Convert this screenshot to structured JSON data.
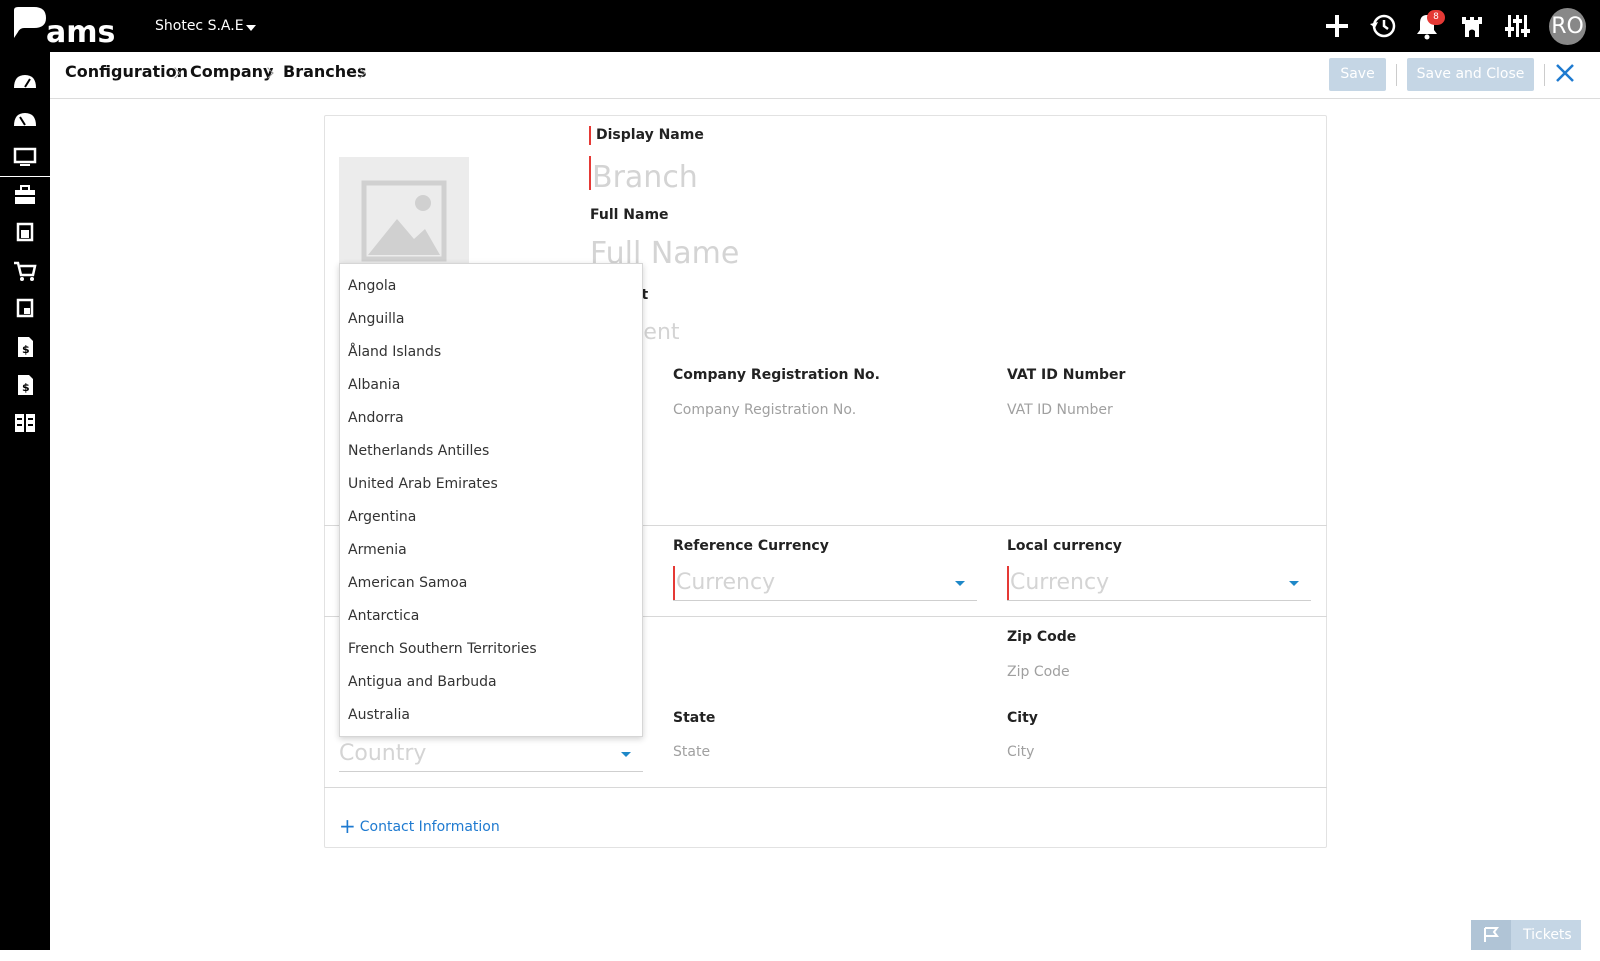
{
  "app": {
    "logo": "Pams",
    "company": "Shotec S.A.E"
  },
  "topbar": {
    "notification_count": "8",
    "avatar_initials": "RO"
  },
  "breadcrumb": [
    "Configuration",
    "Company",
    "Branches"
  ],
  "toolbar": {
    "save_label": "Save",
    "save_close_label": "Save and Close"
  },
  "form": {
    "display_name_label": "Display Name",
    "display_name_placeholder": "Branch",
    "full_name_label": "Full Name",
    "full_name_placeholder": "Full Name",
    "comment_label_partial": "ent",
    "comment_placeholder_partial": "ment",
    "company_reg_label": "Company Registration No.",
    "company_reg_placeholder": "Company Registration No.",
    "vat_label": "VAT ID Number",
    "vat_placeholder": "VAT ID Number",
    "ref_currency_label": "Reference Currency",
    "ref_currency_placeholder": "Currency",
    "local_currency_label": "Local currency",
    "local_currency_placeholder": "Currency",
    "zip_label": "Zip Code",
    "zip_placeholder": "Zip Code",
    "state_label": "State",
    "state_placeholder": "State",
    "city_label": "City",
    "city_placeholder": "City",
    "country_placeholder": "Country",
    "contact_info_label": "Contact Information"
  },
  "country_dropdown": {
    "options": [
      "Angola",
      "Anguilla",
      "Åland Islands",
      "Albania",
      "Andorra",
      "Netherlands Antilles",
      "United Arab Emirates",
      "Argentina",
      "Armenia",
      "American Samoa",
      "Antarctica",
      "French Southern Territories",
      "Antigua and Barbuda",
      "Australia"
    ]
  },
  "footer": {
    "tickets_label": "Tickets"
  },
  "colors": {
    "accent": "#1e88c8",
    "required": "#e53935",
    "disabled_button": "#c5d6e5"
  }
}
